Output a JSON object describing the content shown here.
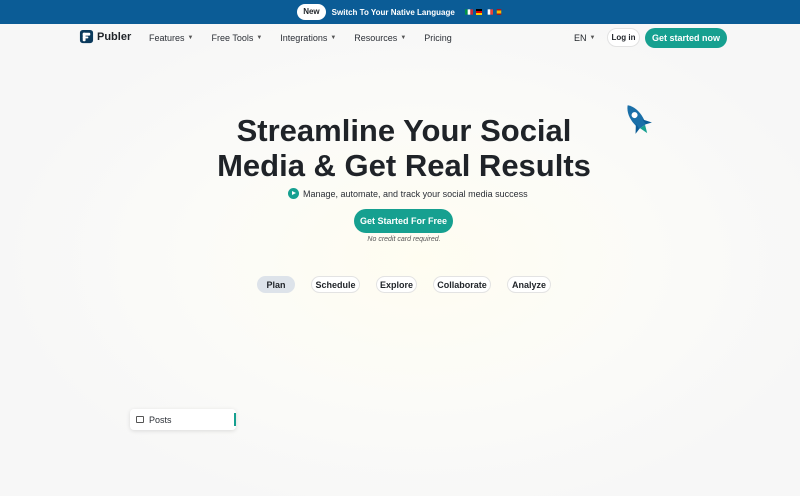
{
  "promo": {
    "badge": "New",
    "text": "Switch To Your Native Language",
    "flags": [
      "flag-it",
      "flag-de",
      "flag-fr",
      "flag-es"
    ]
  },
  "nav": {
    "brand": "Publer",
    "menu": [
      {
        "label": "Features",
        "has_dropdown": true
      },
      {
        "label": "Free Tools",
        "has_dropdown": true
      },
      {
        "label": "Integrations",
        "has_dropdown": true
      },
      {
        "label": "Resources",
        "has_dropdown": true
      },
      {
        "label": "Pricing",
        "has_dropdown": false
      }
    ],
    "language": "EN",
    "login": "Log in",
    "cta": "Get started now"
  },
  "hero": {
    "title": "Streamline Your Social Media & Get Real Results",
    "subtitle": "Manage, automate, and track your social media success",
    "cta": "Get Started For Free",
    "note": "No credit card required."
  },
  "tabs": [
    {
      "label": "Plan",
      "active": true
    },
    {
      "label": "Schedule",
      "active": false
    },
    {
      "label": "Explore",
      "active": false
    },
    {
      "label": "Collaborate",
      "active": false
    },
    {
      "label": "Analyze",
      "active": false
    }
  ],
  "card": {
    "label": "Posts"
  },
  "colors": {
    "accent": "#16a090",
    "promo_bg": "#0b5c96",
    "active_tab": "#dde3ea"
  }
}
